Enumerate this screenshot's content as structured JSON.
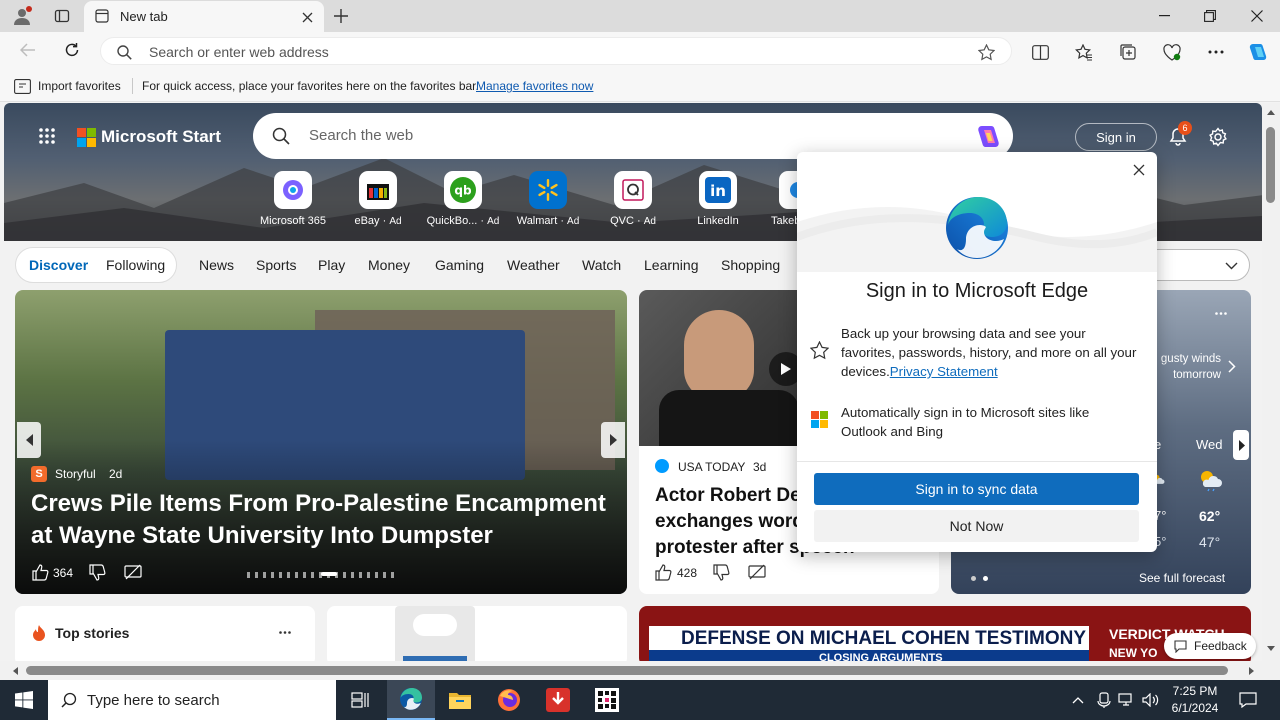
{
  "browser": {
    "tab_title": "New tab",
    "address_placeholder": "Search or enter web address"
  },
  "favorites_bar": {
    "import_label": "Import favorites",
    "hint_text": "For quick access, place your favorites here on the favorites bar.",
    "manage_link": "Manage favorites now"
  },
  "msn": {
    "brand": "Microsoft Start",
    "search_placeholder": "Search the web",
    "sign_in_label": "Sign in",
    "notification_count": "6",
    "quick_links": [
      {
        "label": "Microsoft 365",
        "ad": ""
      },
      {
        "label": "eBay",
        "ad": "Ad"
      },
      {
        "label": "QuickBo...",
        "ad": "Ad"
      },
      {
        "label": "Walmart",
        "ad": "Ad"
      },
      {
        "label": "QVC",
        "ad": "Ad"
      },
      {
        "label": "LinkedIn",
        "ad": ""
      },
      {
        "label": "Takeb",
        "ad": ""
      }
    ],
    "nav": {
      "discover": "Discover",
      "following": "Following",
      "items": [
        "News",
        "Sports",
        "Play",
        "Money",
        "Gaming",
        "Weather",
        "Watch",
        "Learning",
        "Shopping"
      ]
    },
    "hero_story": {
      "source": "Storyful",
      "age": "2d",
      "headline": "Crews Pile Items From Pro-Palestine Encampment at Wayne State University Into Dumpster",
      "likes": "364"
    },
    "second_story": {
      "source": "USA TODAY",
      "age": "3d",
      "headline": "Actor Robert De Niro exchanges words with protester after speech",
      "likes": "428"
    },
    "weather": {
      "alert": "gusty winds tomorrow",
      "day_partial": "e",
      "day": "Wed",
      "high": "62°",
      "low": "47°",
      "partial_high": "7°",
      "partial_low": "5°",
      "forecast_link": "See full forecast"
    },
    "top_stories_label": "Top stories",
    "ticker_text": "DEFENSE ON MICHAEL COHEN TESTIMONY",
    "ticker_sub": "CLOSING ARGUMENTS",
    "ticker_right": "VERDICT WATCH",
    "ticker_right_sub": "NEW YO",
    "feedback_label": "Feedback"
  },
  "popup": {
    "title": "Sign in to Microsoft Edge",
    "item1_text": "Back up your browsing data and see your favorites, passwords, history, and more on all your devices.",
    "item1_link": "Privacy Statement",
    "item2_text": "Automatically sign in to Microsoft sites like Outlook and Bing",
    "primary_button": "Sign in to sync data",
    "secondary_button": "Not Now"
  },
  "taskbar": {
    "search_placeholder": "Type here to search",
    "time": "7:25 PM",
    "date": "6/1/2024"
  },
  "colors": {
    "edge_blue": "#0f6cbd",
    "msn_blue": "#0067b8",
    "taskbar": "#1f2a36"
  }
}
